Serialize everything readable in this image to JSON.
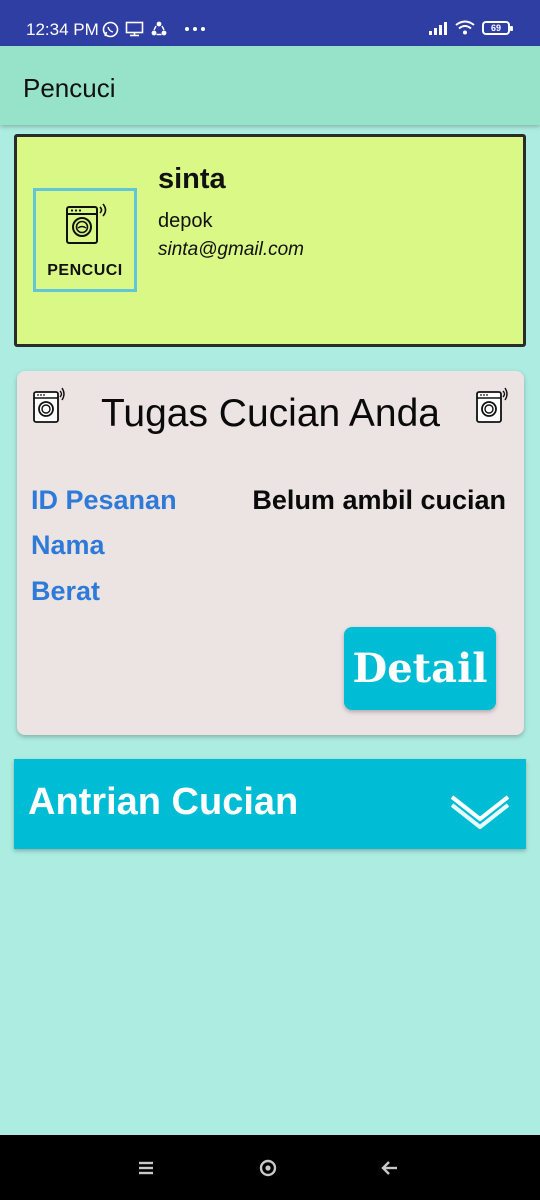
{
  "status_bar": {
    "time": "12:34 PM",
    "battery": "69"
  },
  "app_bar": {
    "title": "Pencuci"
  },
  "profile": {
    "logo_text": "PENCUCI",
    "name": "sinta",
    "city": "depok",
    "email": "sinta@gmail.com"
  },
  "task_card": {
    "title": "Tugas Cucian Anda",
    "labels": {
      "id": "ID Pesanan",
      "nama": "Nama",
      "berat": "Berat"
    },
    "status": "Belum ambil cucian",
    "detail_label": "Detail"
  },
  "queue": {
    "title": "Antrian Cucian"
  },
  "colors": {
    "status_bar": "#2f3ea3",
    "app_bar": "#97e3ca",
    "background": "#adece1",
    "profile_card": "#daf885",
    "task_card": "#ece3e3",
    "accent": "#00bcd4",
    "label_blue": "#2e7ad8"
  }
}
